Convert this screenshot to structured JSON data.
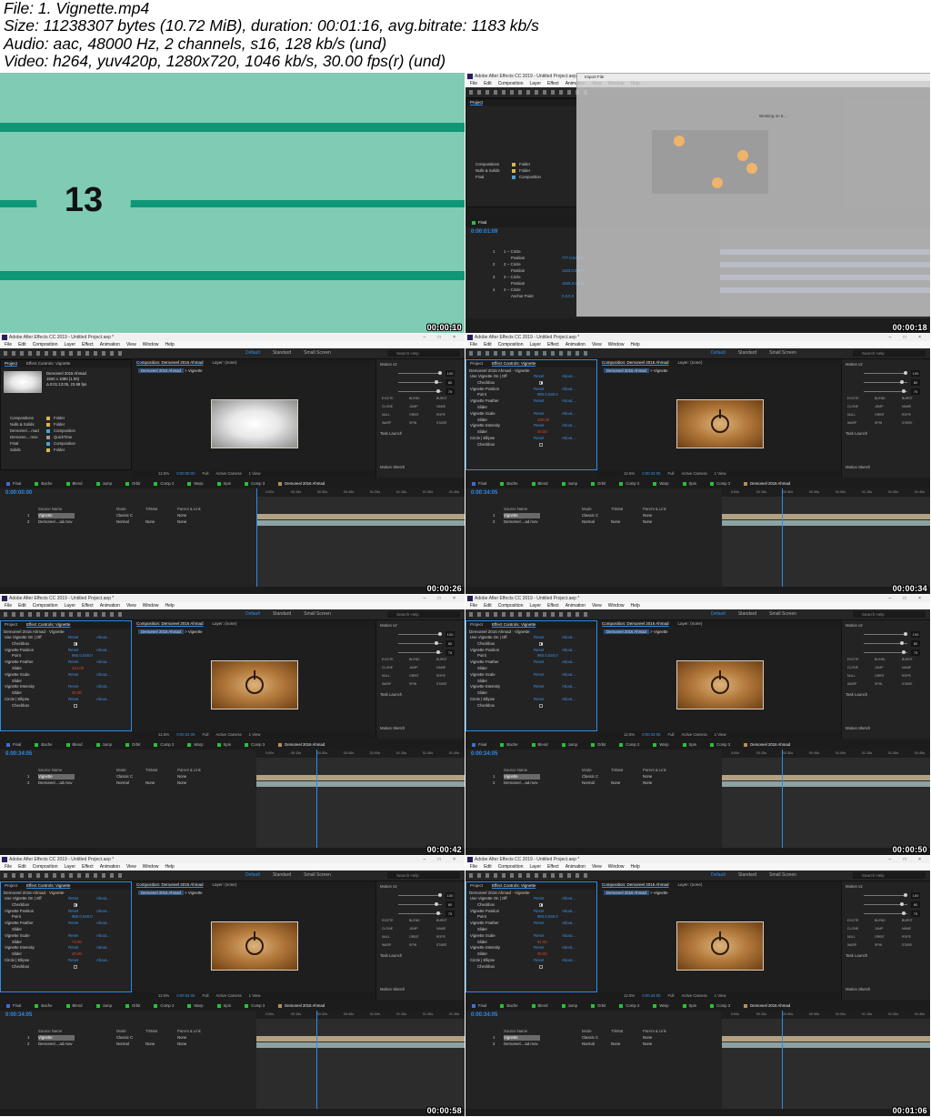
{
  "header": {
    "line1": "File: 1. Vignette.mp4",
    "line2": "Size: 11238307 bytes (10.72 MiB), duration: 00:01:16, avg.bitrate: 1183 kb/s",
    "line3": "Audio: aac, 48000 Hz, 2 channels, s16, 128 kb/s (und)",
    "line4": "Video: h264, yuv420p, 1280x720, 1046 kb/s, 30.00 fps(r) (und)"
  },
  "intro": {
    "number": "13",
    "timestamp": "00:00:10"
  },
  "app": {
    "title": "Adobe After Effects CC 2019 - Untitled Project.aep *",
    "menu": [
      "File",
      "Edit",
      "Composition",
      "Layer",
      "Effect",
      "Animation",
      "View",
      "Window",
      "Help"
    ],
    "workspaces": [
      "Default",
      "Standard",
      "Small Screen"
    ],
    "search_help": "Search Help",
    "colors": {
      "accent": "#2d8ceb",
      "panel": "#232323",
      "frame_bg": "#1d1d1d"
    }
  },
  "import_frame": {
    "timestamp": "00:00:18",
    "dialog_title": "Import File",
    "working": "Working on it...",
    "project_tab": "Project",
    "project_items": [
      {
        "name": "Compositions",
        "type": "Folder",
        "color": "#d8b94a"
      },
      {
        "name": "Nulls & Solids",
        "type": "Folder",
        "color": "#d8b94a"
      },
      {
        "name": "Final",
        "type": "Composition",
        "size": "25",
        "color": "#4aa0d8"
      }
    ],
    "comp_tab": "Final",
    "timecode": "0:00:01:09",
    "layers": [
      {
        "num": "1",
        "name": "1 -- Circle",
        "sub": "Position",
        "val": "777.0,540.0"
      },
      {
        "num": "2",
        "name": "2 -- Circle",
        "sub": "Position",
        "val": "1163.0,540.0"
      },
      {
        "num": "3",
        "name": "3 -- Circle",
        "sub": "Position",
        "val": "1548.0,540.0"
      },
      {
        "num": "4",
        "name": "4 -- Circle",
        "sub": "Anchor Point",
        "val": "0.0,0.0"
      }
    ]
  },
  "common": {
    "project_tab": "Project",
    "effect_controls": "Effect Controls: Vignette",
    "comp_tab_label": "Composition: Demoreel 2016 Ahmad",
    "comp_viewer_tab": "Demoreel 2016 Ahmad",
    "vignette_tab": "Vignette",
    "layer_none": "Layer: (none)",
    "zoom": "12.5%",
    "quality": "Full",
    "camera": "Active Camera",
    "view": "1 View",
    "motion_panel": "Motion v2",
    "task_launch": "Task Launch",
    "motion_sketch": "Motion Sketch",
    "motion_buttons": [
      "EXCITE",
      "BLEND",
      "BURST",
      "CLONE",
      "JUMP",
      "NAME",
      "NULL",
      "ORBIT",
      "ROPE",
      "WARP",
      "SPIN",
      "STARE"
    ],
    "slider_values": [
      "100",
      "80",
      "75"
    ],
    "timeline_tabs": [
      "Final",
      "Bache",
      "Blend",
      "Jump",
      "Orbit",
      "Comp 2",
      "Warp",
      "Spin",
      "Comp 3",
      "Demoreel 2016 Ahmad"
    ],
    "ruler": [
      "0:00s",
      "00:15s",
      "00:30s",
      "00:45s",
      "01:00s",
      "01:15s",
      "01:30s",
      "01:45s"
    ],
    "columns": {
      "source_name": "Source Name",
      "mode": "Mode",
      "trkmat": "TrkMat",
      "parent": "Parent & Link"
    },
    "layer1": {
      "num": "1",
      "name": "Vignette",
      "mode": "Classic C",
      "parent": "None"
    },
    "layer2": {
      "num": "2",
      "name": "Demoreel....ad.mov",
      "mode": "Normal",
      "trk": "None",
      "parent": "None"
    },
    "effect_title": "Demoreel 2016 Ahmad · Vignette",
    "props": {
      "use_vignette": "Use Vignette On | Off",
      "checkbox": "Checkbox",
      "position": "Vignette Position",
      "point": "Point",
      "point_val": "960.0,540.0",
      "feather": "Vignette Feather",
      "slider": "Slider",
      "scale": "Vignette Scale",
      "intensity": "Vignette Intensity",
      "circle": "Circle | Ellipse",
      "reset": "Reset",
      "about": "About..."
    }
  },
  "frames": [
    {
      "id": "f26",
      "timestamp": "00:00:26",
      "timecode": "0:00:00:00",
      "project": true,
      "proj_name": "Demoreel 2016 Ahmad",
      "proj_meta": [
        "1920 x 1080 (1.00)",
        "Δ 0:01:13:05, 23.98 fps"
      ],
      "proj_items": [
        {
          "name": "Compositions",
          "type": "Folder",
          "color": "#d8b94a"
        },
        {
          "name": "Nulls & Solids",
          "type": "Folder",
          "color": "#d8b94a"
        },
        {
          "name": "Demoreel....mad",
          "type": "Composition",
          "size": "25",
          "color": "#4aa0d8"
        },
        {
          "name": "Demoree....mov",
          "type": "QuickTime",
          "size": "960 MB",
          "color": "#9a9a9a"
        },
        {
          "name": "Final",
          "type": "Composition",
          "size": "25",
          "color": "#4aa0d8"
        },
        {
          "name": "Solids",
          "type": "Folder",
          "color": "#d8b94a"
        }
      ]
    },
    {
      "id": "f34",
      "timestamp": "00:00:34",
      "timecode": "0:00:34:05",
      "feather": "",
      "scale": "100.00",
      "intensity": "30.00"
    },
    {
      "id": "f42",
      "timestamp": "00:00:42",
      "timecode": "0:00:34:05",
      "feather": "314.00",
      "scale": "",
      "intensity": "30.00"
    },
    {
      "id": "f50",
      "timestamp": "00:00:50",
      "timecode": "0:00:34:05",
      "feather": "",
      "scale": "",
      "intensity": ""
    },
    {
      "id": "f58",
      "timestamp": "00:00:58",
      "timecode": "0:00:34:05",
      "feather": "",
      "scale": "74.00",
      "intensity": "30.00"
    },
    {
      "id": "f106",
      "timestamp": "00:01:06",
      "timecode": "0:00:34:05",
      "feather": "",
      "scale": "91.00",
      "intensity": "30.00"
    }
  ]
}
